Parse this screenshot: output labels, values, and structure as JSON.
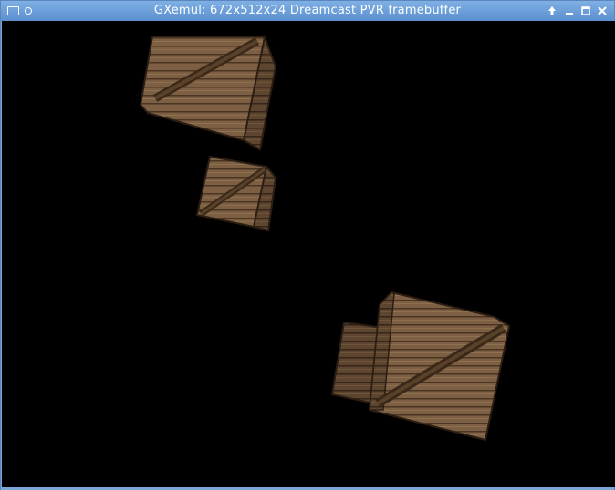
{
  "window": {
    "title": "GXemul: 672x512x24 Dreamcast PVR framebuffer",
    "titlebar_buttons": [
      {
        "name": "shade-up",
        "icon": "arrow-up-icon"
      },
      {
        "name": "minimize",
        "icon": "minimize-icon"
      },
      {
        "name": "maximize",
        "icon": "maximize-icon"
      },
      {
        "name": "close",
        "icon": "close-icon"
      }
    ]
  },
  "colors": {
    "titlebar": "#6a9ddb",
    "framebuffer": "#000000",
    "crate_wood": "#8a6a47",
    "crate_dark": "#3a2a1a"
  }
}
